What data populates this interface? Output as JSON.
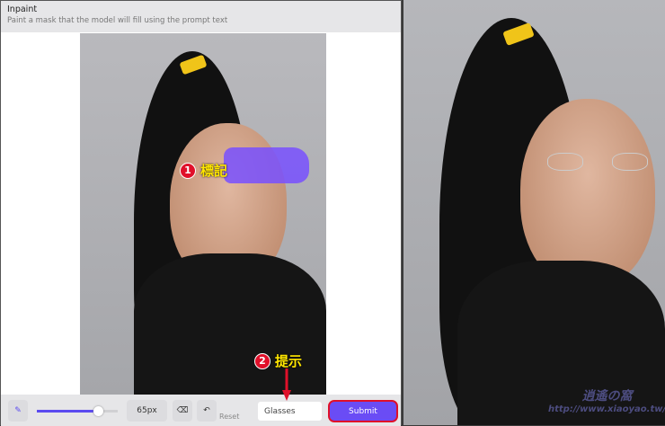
{
  "header": {
    "title": "Inpaint",
    "subtitle": "Paint a mask that the model will fill using the prompt text"
  },
  "toolbar": {
    "brush_size": "65px",
    "reset_label": "Reset",
    "prompt_value": "Glasses",
    "submit_label": "Submit",
    "brush_fraction": 0.75
  },
  "annotations": [
    {
      "num": "1",
      "label": "標記"
    },
    {
      "num": "2",
      "label": "提示"
    }
  ],
  "watermark": {
    "text": "http://www.xiaoyao.tw/",
    "logo": "逍遙の窩"
  },
  "colors": {
    "accent": "#6a4cf5",
    "mask": "#7850ff",
    "highlight": "#e0102a"
  }
}
